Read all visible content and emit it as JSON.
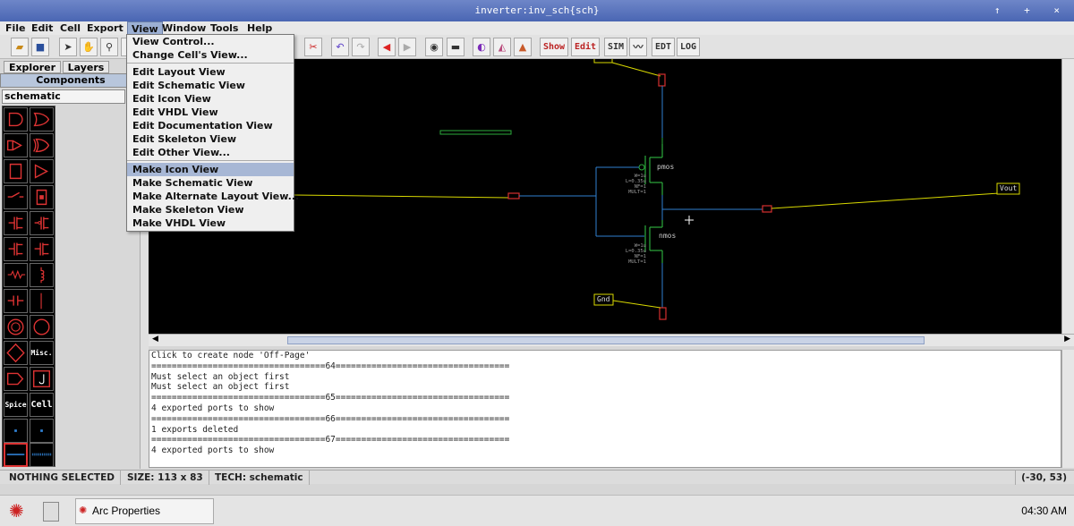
{
  "window": {
    "title": "inverter:inv_sch{sch}",
    "controls": "↑ + ×"
  },
  "menubar": [
    "File",
    "Edit",
    "Cell",
    "Export",
    "View",
    "Window",
    "Tools",
    "Help"
  ],
  "view_menu": {
    "group1": [
      "View Control...",
      "Change Cell's View..."
    ],
    "group2": [
      "Edit Layout View",
      "Edit Schematic View",
      "Edit Icon View",
      "Edit VHDL View",
      "Edit Documentation View",
      "Edit Skeleton View",
      "Edit Other View..."
    ],
    "group3": [
      "Make Icon View",
      "Make Schematic View",
      "Make Alternate Layout View...",
      "Make Skeleton View",
      "Make VHDL View"
    ],
    "highlighted": "Make Icon View"
  },
  "toolbar": {
    "show": "Show",
    "edit": "Edit",
    "sim": "SIM",
    "edt": "EDT",
    "log": "LOG"
  },
  "left_panel": {
    "tabs": [
      "Explorer",
      "Layers"
    ],
    "components_header": "Components",
    "view_select": "schematic",
    "palette_text": {
      "misc": "Misc.",
      "spice": "Spice",
      "cell": "Cell"
    }
  },
  "schematic": {
    "pmos": {
      "label": "pmos",
      "params": [
        "W=1u",
        "L=0.35u",
        "NF=1",
        "MULT=1"
      ]
    },
    "nmos": {
      "label": "nmos",
      "params": [
        "W=1u",
        "L=0.35u",
        "NF=1",
        "MULT=1"
      ]
    },
    "exports": {
      "vout": "Vout",
      "gnd": "Gnd"
    }
  },
  "messages": [
    "Click to create node 'Off-Page'",
    "==================================64==================================",
    "Must select an object first",
    "Must select an object first",
    "==================================65==================================",
    "4 exported ports to show",
    "==================================66==================================",
    "1 exports deleted",
    "==================================67==================================",
    "4 exported ports to show"
  ],
  "status": {
    "selection": "NOTHING SELECTED",
    "size": "SIZE: 113 x 83",
    "tech": "TECH: schematic",
    "coords": "(-30, 53)"
  },
  "taskbar": {
    "task": "Arc Properties",
    "clock": "04:30 AM"
  },
  "colors": {
    "canvas_bg": "#000000",
    "wire_blue": "#2f7fd0",
    "wire_yellow": "#d9d900",
    "contact_red": "#d43030",
    "transistor_green": "#2dab3c"
  }
}
